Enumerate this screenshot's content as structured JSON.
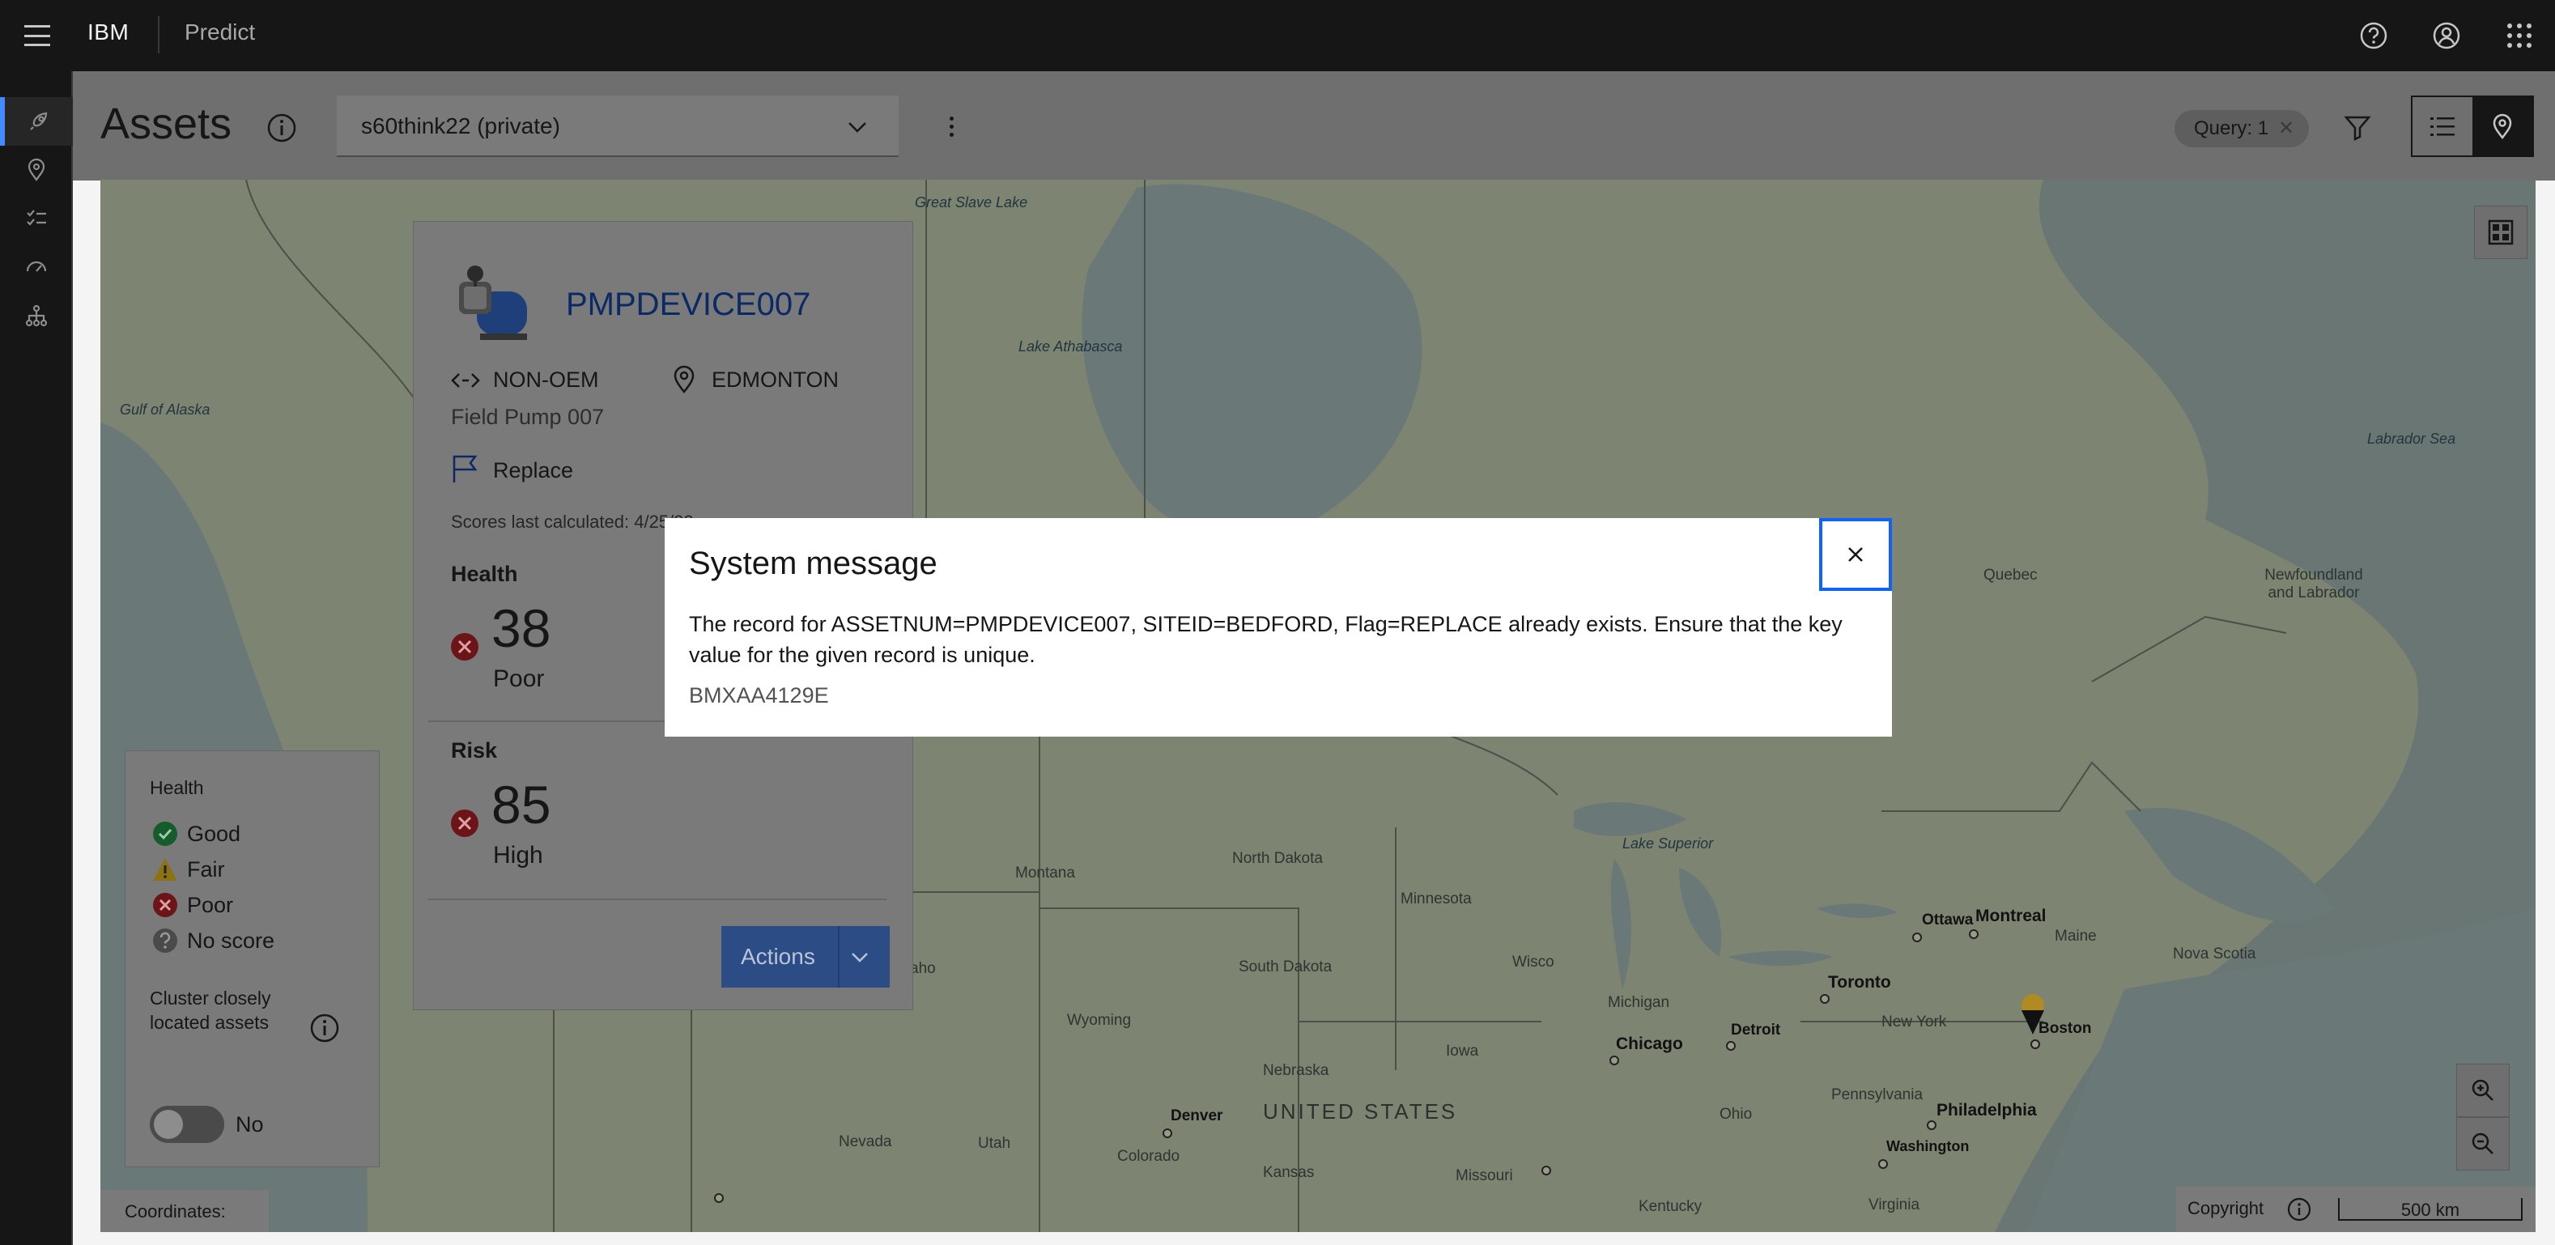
{
  "header": {
    "brand": "IBM",
    "product": "Predict"
  },
  "page": {
    "title": "Assets",
    "repository_select": "s60think22 (private)",
    "query_tag": "Query: 1"
  },
  "asset_card": {
    "asset_id": "PMPDEVICE007",
    "manufacturer": "NON-OEM",
    "location": "EDMONTON",
    "description": "Field Pump 007",
    "flag": "Replace",
    "scores_note": "Scores last calculated: 4/25/22",
    "health": {
      "label": "Health",
      "value": "38",
      "rating": "Poor"
    },
    "risk": {
      "label": "Risk",
      "value": "85",
      "rating": "High"
    },
    "actions_label": "Actions"
  },
  "legend": {
    "title": "Health",
    "items": [
      {
        "label": "Good",
        "icon": "checkmark-filled-icon",
        "color": "#24a148"
      },
      {
        "label": "Fair",
        "icon": "warning-alt-filled-icon",
        "color": "#f1c21b"
      },
      {
        "label": "Poor",
        "icon": "error-filled-icon",
        "color": "#da1e28"
      },
      {
        "label": "No score",
        "icon": "help-filled-icon",
        "color": "#8d8d8d"
      }
    ],
    "cluster_label": "Cluster closely located assets",
    "toggle_state": "No"
  },
  "map": {
    "coordinates_label": "Coordinates:",
    "copyright": "Copyright",
    "scale": "500 km",
    "labels": {
      "great_slave_lake": "Great Slave Lake",
      "lake_athabasca": "Lake Athabasca",
      "gulf_of_alaska": "Gulf of Alaska",
      "labrador_sea": "Labrador Sea",
      "quebec": "Quebec",
      "newfoundland": "Newfoundland and Labrador",
      "north_dakota": "North Dakota",
      "montana": "Montana",
      "minnesota": "Minnesota",
      "south_dakota": "South Dakota",
      "wyoming": "Wyoming",
      "iowa": "Iowa",
      "nebraska": "Nebraska",
      "united_states": "UNITED STATES",
      "nevada": "Nevada",
      "utah": "Utah",
      "colorado": "Colorado",
      "kansas": "Kansas",
      "missouri": "Missouri",
      "kentucky": "Kentucky",
      "virginia": "Virginia",
      "ohio": "Ohio",
      "pennsylvania": "Pennsylvania",
      "new_york": "New York",
      "michigan": "Michigan",
      "wisconsin": "Wisco",
      "maine": "Maine",
      "nova_scotia": "Nova Scotia",
      "lake_superior": "Lake Superior",
      "idaho": "aho",
      "ottawa": "Ottawa",
      "montreal": "Montreal",
      "toronto": "Toronto",
      "boston": "Boston",
      "chicago": "Chicago",
      "detroit": "Detroit",
      "denver": "Denver",
      "philadelphia": "Philadelphia",
      "washington": "Washington"
    }
  },
  "modal": {
    "title": "System message",
    "body": "The record for ASSETNUM=PMPDEVICE007, SITEID=BEDFORD, Flag=REPLACE already exists. Ensure that the key value for the given record is unique.",
    "code": "BMXAA4129E"
  }
}
